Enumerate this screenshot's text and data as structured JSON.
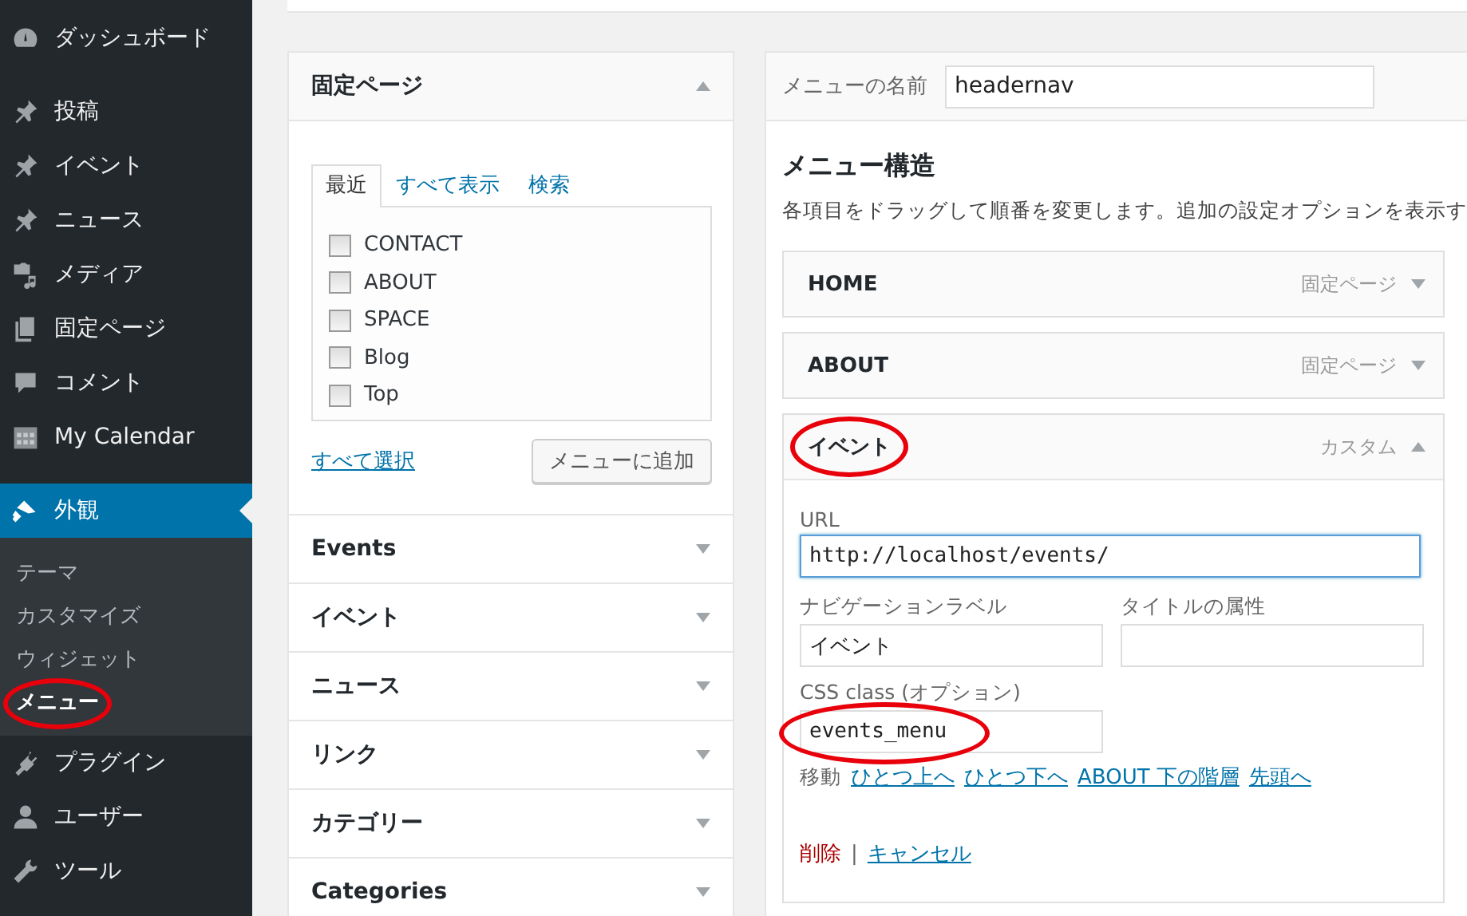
{
  "sidebar": {
    "items": [
      {
        "label": "ダッシュボード",
        "selected": false
      },
      {
        "label": "投稿",
        "selected": false
      },
      {
        "label": "イベント",
        "selected": false
      },
      {
        "label": "ニュース",
        "selected": false
      },
      {
        "label": "メディア",
        "selected": false
      },
      {
        "label": "固定ページ",
        "selected": false
      },
      {
        "label": "コメント",
        "selected": false
      },
      {
        "label": "My Calendar",
        "selected": false
      },
      {
        "label": "外観",
        "selected": true,
        "children": [
          {
            "label": "テーマ",
            "selected": false,
            "highlighted": false
          },
          {
            "label": "カスタマイズ",
            "selected": false,
            "highlighted": false
          },
          {
            "label": "ウィジェット",
            "selected": false,
            "highlighted": false
          },
          {
            "label": "メニュー",
            "selected": true,
            "highlighted": true
          }
        ]
      },
      {
        "label": "プラグイン",
        "selected": false
      },
      {
        "label": "ユーザー",
        "selected": false
      },
      {
        "label": "ツール",
        "selected": false
      }
    ]
  },
  "add_panels": [
    {
      "title": "固定ページ",
      "expanded": true,
      "tabs": [
        {
          "label": "最近",
          "selected": true
        },
        {
          "label": "すべて表示",
          "selected": false
        },
        {
          "label": "検索",
          "selected": false
        }
      ],
      "pages": [
        {
          "label": "CONTACT",
          "checked": false
        },
        {
          "label": "ABOUT",
          "checked": false
        },
        {
          "label": "SPACE",
          "checked": false
        },
        {
          "label": "Blog",
          "checked": false
        },
        {
          "label": "Top",
          "checked": false
        }
      ],
      "select_all": "すべて選択",
      "add_button": "メニューに追加"
    },
    {
      "title": "Events",
      "expanded": false
    },
    {
      "title": "イベント",
      "expanded": false
    },
    {
      "title": "ニュース",
      "expanded": false
    },
    {
      "title": "リンク",
      "expanded": false
    },
    {
      "title": "カテゴリー",
      "expanded": false
    },
    {
      "title": "Categories",
      "expanded": false
    }
  ],
  "menu_editor": {
    "name_label": "メニューの名前",
    "name_value": "headernav",
    "structure_title": "メニュー構造",
    "description": "各項目をドラッグして順番を変更します。追加の設定オプションを表示す",
    "items": [
      {
        "title": "HOME",
        "type": "固定ページ",
        "expanded": false,
        "highlighted": false
      },
      {
        "title": "ABOUT",
        "type": "固定ページ",
        "expanded": false,
        "highlighted": false
      },
      {
        "title": "イベント",
        "type": "カスタム",
        "expanded": true,
        "highlighted": true,
        "settings": {
          "url_label": "URL",
          "url_value": "http://localhost/events/",
          "url_focused": true,
          "nav_label": "ナビゲーションラベル",
          "nav_value": "イベント",
          "title_attr_label": "タイトルの属性",
          "css_label": "CSS class (オプション)",
          "css_value": "events_menu",
          "css_highlighted": true,
          "move_label": "移動",
          "move_links": [
            "ひとつ上へ",
            "ひとつ下へ",
            "ABOUT 下の階層",
            "先頭へ"
          ],
          "delete": "削除",
          "separator": "|",
          "cancel": "キャンセル"
        }
      }
    ]
  }
}
